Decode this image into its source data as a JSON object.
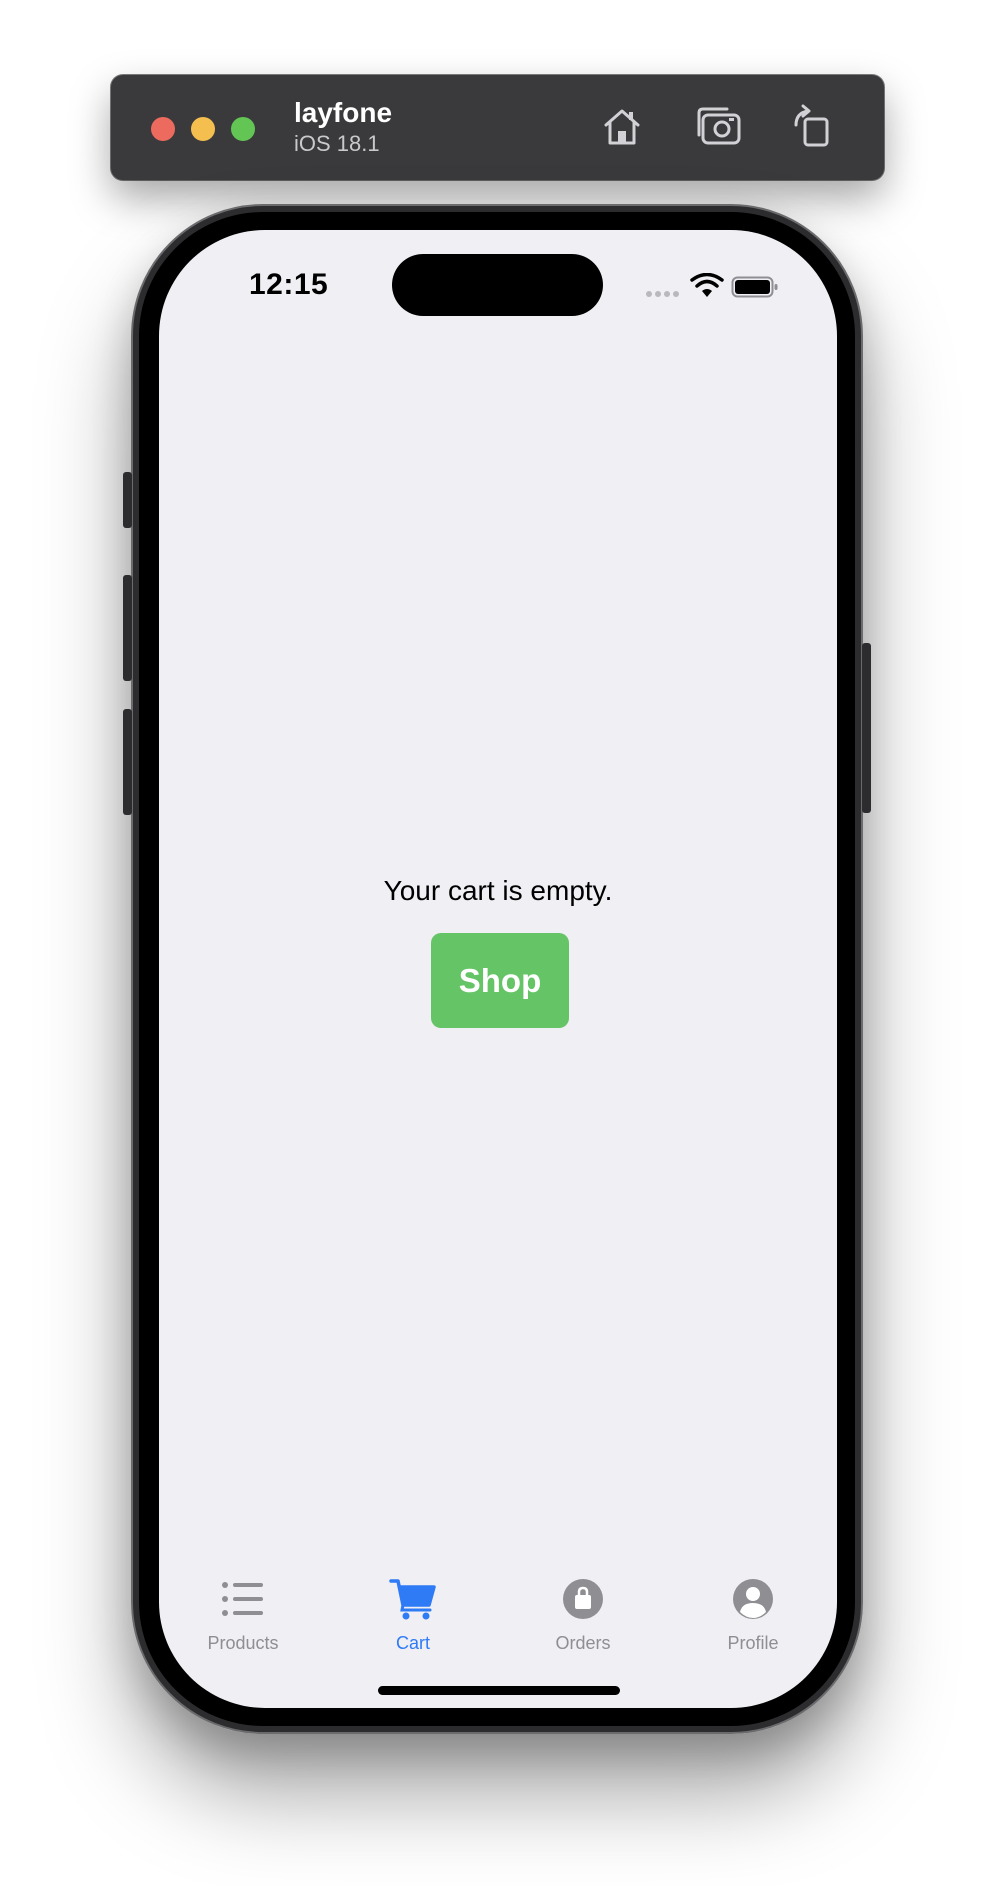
{
  "window": {
    "app_name": "layfone",
    "os_version": "iOS 18.1",
    "toolbar_icons": [
      "home-icon",
      "screenshot-icon",
      "rotate-icon"
    ]
  },
  "status_bar": {
    "time": "12:15",
    "icons": [
      "cellular-signal-icon",
      "wifi-icon",
      "battery-icon"
    ]
  },
  "cart": {
    "empty_message": "Your cart is empty.",
    "shop_button_label": "Shop"
  },
  "tab_bar": {
    "items": [
      {
        "label": "Products",
        "icon": "list-icon",
        "active": false
      },
      {
        "label": "Cart",
        "icon": "cart-icon",
        "active": true
      },
      {
        "label": "Orders",
        "icon": "bag-icon",
        "active": false
      },
      {
        "label": "Profile",
        "icon": "person-circle-icon",
        "active": false
      }
    ]
  },
  "colors": {
    "accent": "#2f7bf6",
    "shop_button": "#65c466",
    "screen_background": "#efeff4",
    "inactive_tab": "#8e8e93"
  }
}
